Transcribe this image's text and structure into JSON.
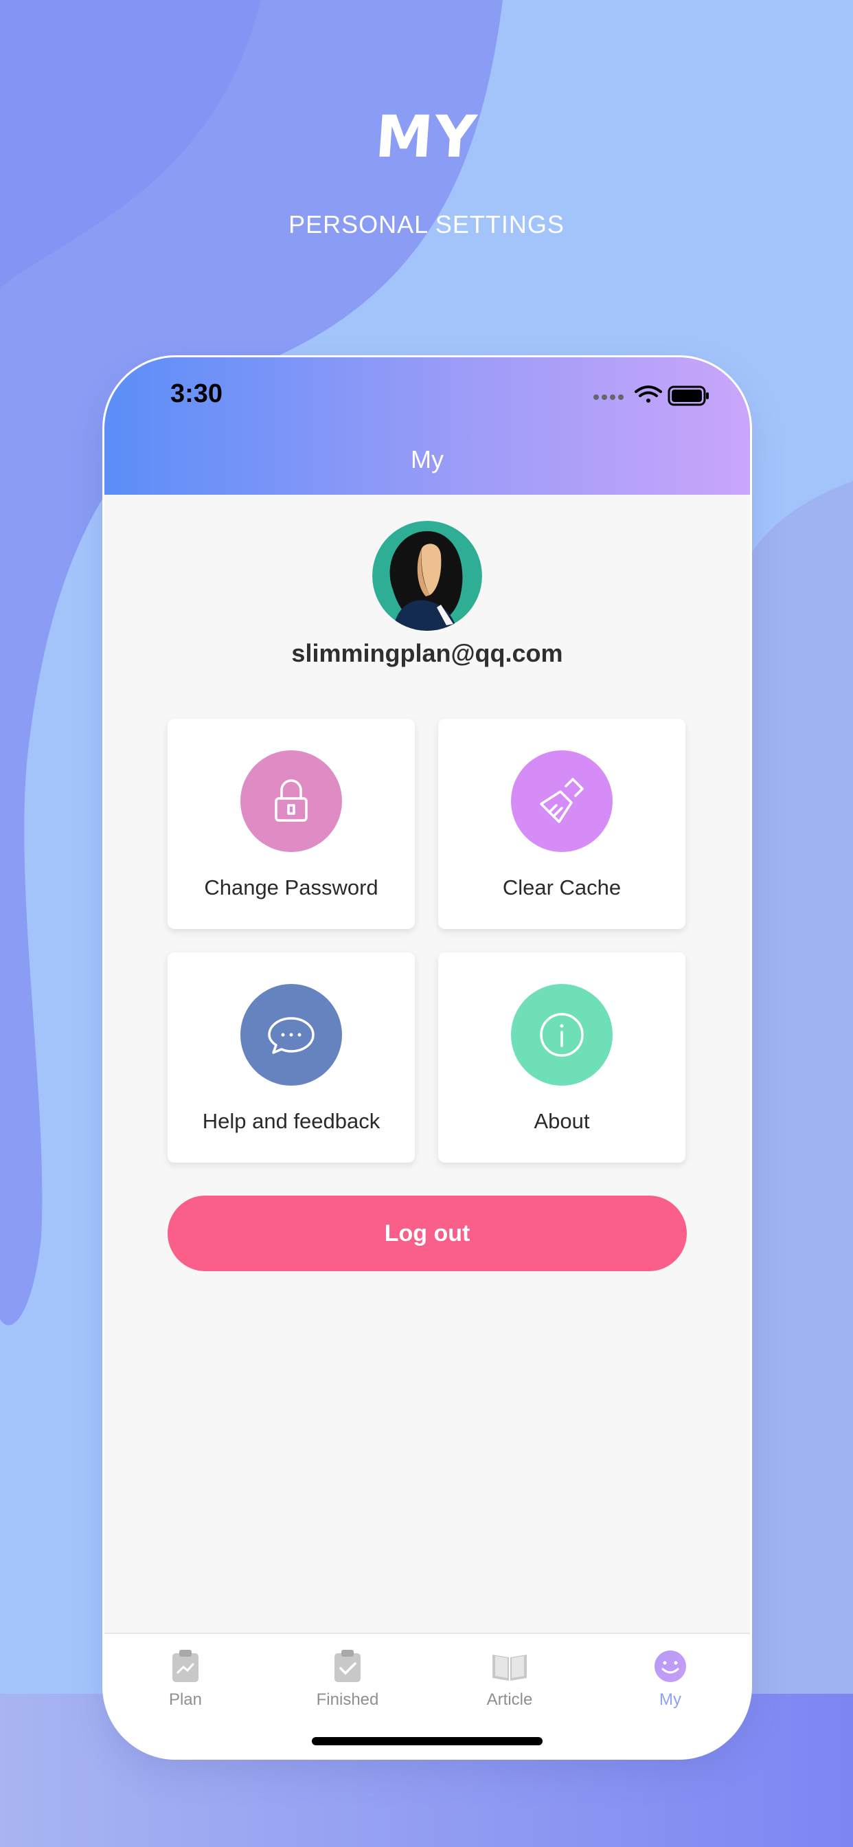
{
  "promo": {
    "headline": "MY",
    "subline": "PERSONAL SETTINGS"
  },
  "status_bar": {
    "time": "3:30"
  },
  "nav": {
    "title": "My"
  },
  "profile": {
    "email": "slimmingplan@qq.com"
  },
  "menu": [
    {
      "label": "Change Password",
      "icon": "lock-icon",
      "color": "#de8cc3"
    },
    {
      "label": "Clear Cache",
      "icon": "broom-icon",
      "color": "#d68cf7"
    },
    {
      "label": "Help and feedback",
      "icon": "chat-bubble-icon",
      "color": "#6583bf"
    },
    {
      "label": "About",
      "icon": "info-icon",
      "color": "#6fdfb7"
    }
  ],
  "logout": {
    "label": "Log out",
    "color": "#fa5f89"
  },
  "tabs": [
    {
      "label": "Plan",
      "icon": "plan-clipboard-icon",
      "active": false
    },
    {
      "label": "Finished",
      "icon": "finished-clipboard-icon",
      "active": false
    },
    {
      "label": "Article",
      "icon": "book-icon",
      "active": false
    },
    {
      "label": "My",
      "icon": "smiley-icon",
      "active": true
    }
  ],
  "colors": {
    "header_gradient_start": "#5b8ef8",
    "header_gradient_end": "#c9a6fb",
    "active_tab": "#8ea2ef"
  }
}
